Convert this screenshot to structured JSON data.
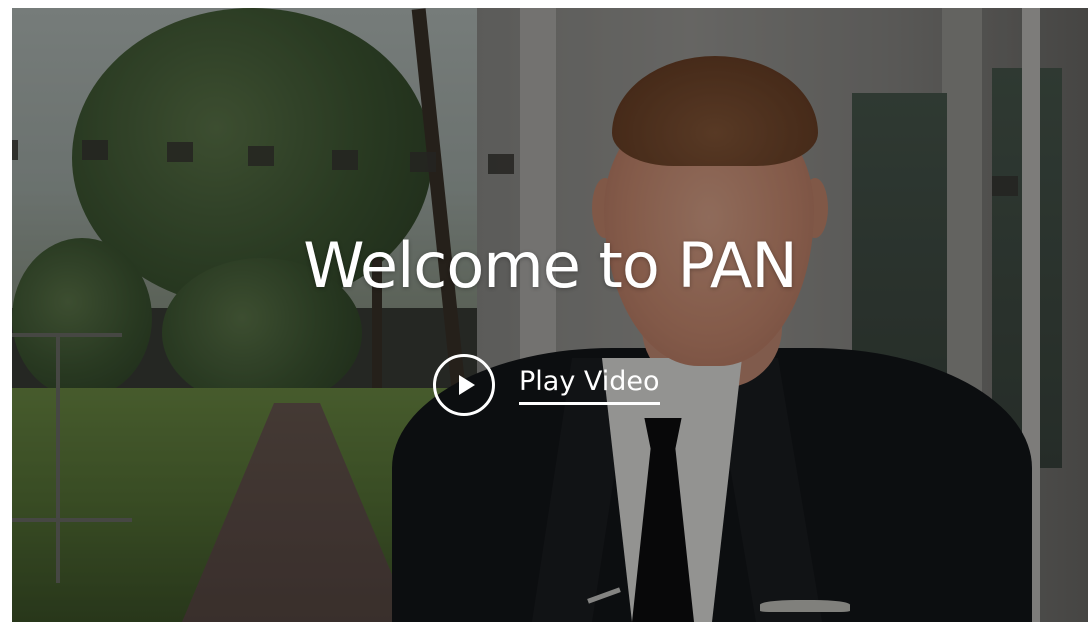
{
  "hero": {
    "headline": "Welcome to PAN",
    "play_label": "Play Video"
  },
  "icons": {
    "play": "play-icon"
  },
  "colors": {
    "text": "#ffffff",
    "overlay": "rgba(0,0,0,0.36)"
  }
}
